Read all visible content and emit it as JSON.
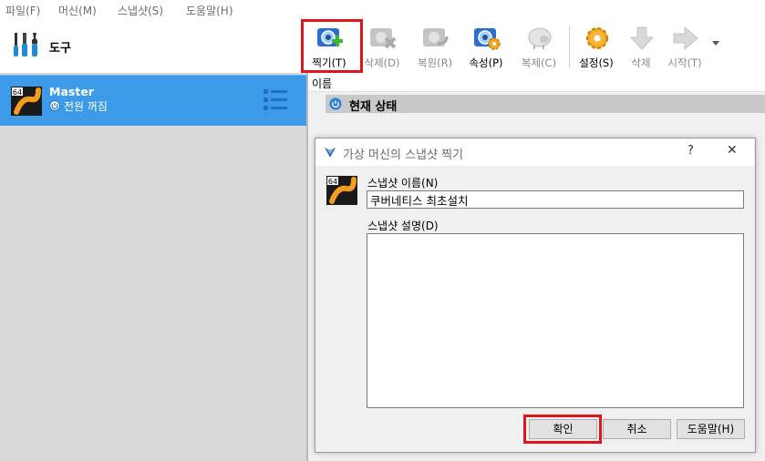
{
  "menu": {
    "file": "파일(F)",
    "machine": "머신(M)",
    "snapshot": "스냅샷(S)",
    "help": "도움말(H)"
  },
  "tools": {
    "label": "도구"
  },
  "vm": {
    "name": "Master",
    "state": "전원 꺼짐",
    "badge": "64"
  },
  "toolbar": {
    "take": "찍기(T)",
    "delete": "삭제(D)",
    "restore": "복원(R)",
    "properties": "속성(P)",
    "clone": "복제(C)",
    "settings": "설정(S)",
    "discard": "삭제",
    "start": "시작(T)"
  },
  "details": {
    "name_header": "이름",
    "current_state": "현재 상태"
  },
  "dialog": {
    "title": "가상 머신의 스냅샷 찍기",
    "help_glyph": "?",
    "close_glyph": "✕",
    "name_label": "스냅샷 이름(N)",
    "name_value": "쿠버네티스 최초설치",
    "desc_label": "스냅샷 설명(D)",
    "desc_value": "",
    "ok": "확인",
    "cancel": "취소",
    "help": "도움말(H)"
  },
  "colors": {
    "selection": "#3d9ae8",
    "highlight": "#e0141c",
    "panel": "#d9d9d9"
  }
}
